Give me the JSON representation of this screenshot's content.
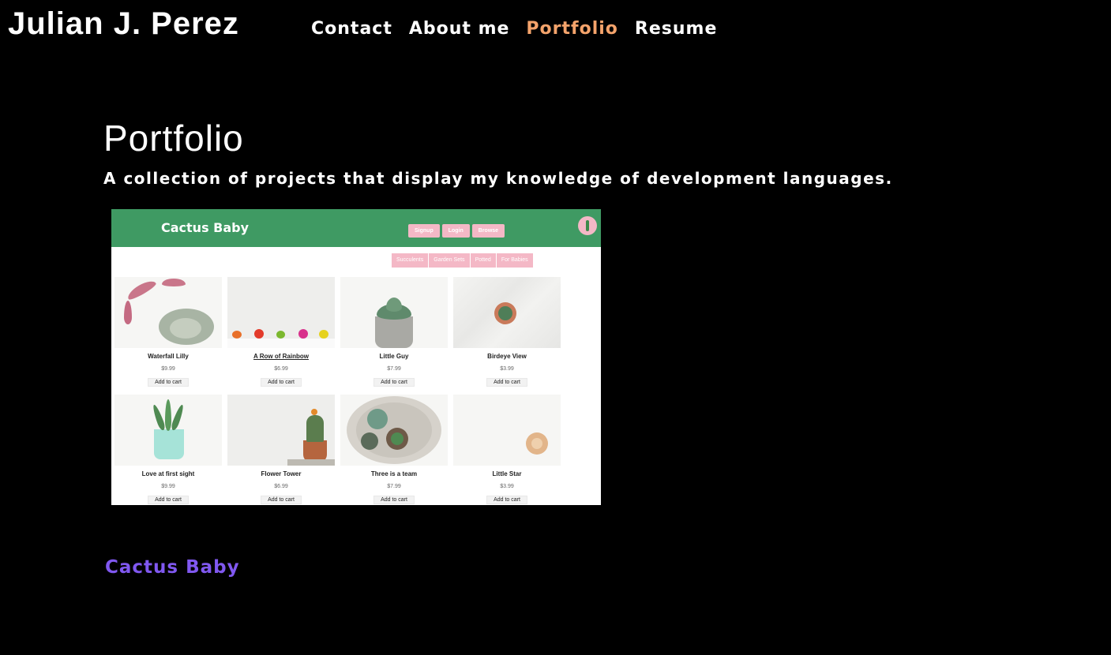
{
  "header": {
    "brand": "Julian J. Perez",
    "nav": [
      {
        "label": "Contact",
        "active": false
      },
      {
        "label": "About me",
        "active": false
      },
      {
        "label": "Portfolio",
        "active": true
      },
      {
        "label": "Resume",
        "active": false
      }
    ]
  },
  "main": {
    "title": "Portfolio",
    "subtitle": "A collection of projects that display my knowledge of development languages.",
    "project": {
      "link_label": "Cactus Baby",
      "screenshot": {
        "brand": "Cactus Baby",
        "buttons": [
          "Signup",
          "Login",
          "Browse"
        ],
        "categories": [
          "Succulents",
          "Garden Sets",
          "Potted",
          "For Babies"
        ],
        "products": [
          {
            "name": "Waterfall Lilly",
            "price": "$9.99",
            "action": "Add to cart"
          },
          {
            "name": "A Row of Rainbow",
            "price": "$6.99",
            "action": "Add to cart"
          },
          {
            "name": "Little Guy",
            "price": "$7.99",
            "action": "Add to cart"
          },
          {
            "name": "Birdeye View",
            "price": "$3.99",
            "action": "Add to cart"
          },
          {
            "name": "Love at first sight",
            "price": "$9.99",
            "action": "Add to cart"
          },
          {
            "name": "Flower Tower",
            "price": "$6.99",
            "action": "Add to cart"
          },
          {
            "name": "Three is a team",
            "price": "$7.99",
            "action": "Add to cart"
          },
          {
            "name": "Little Star",
            "price": "$3.99",
            "action": "Add to cart"
          }
        ]
      }
    }
  },
  "colors": {
    "background": "#000000",
    "text": "#ffffff",
    "nav_active": "#f4a36b",
    "project_link": "#8058f0",
    "shot_header": "#3f9a63",
    "shot_button": "#f4b8c6"
  }
}
